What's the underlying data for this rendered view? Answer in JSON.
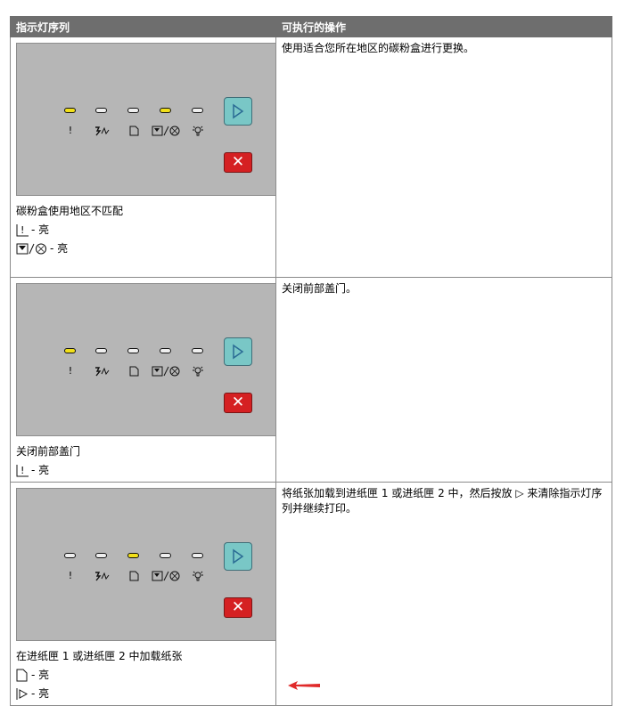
{
  "header": {
    "col1": "指示灯序列",
    "col2": "可执行的操作"
  },
  "rows": [
    {
      "leds": [
        true,
        false,
        false,
        true,
        false
      ],
      "title": "碳粉盒使用地区不匹配",
      "status_lines": [
        "- 亮",
        "- 亮"
      ],
      "action": "使用适合您所在地区的碳粉盒进行更换。"
    },
    {
      "leds": [
        true,
        false,
        false,
        false,
        false
      ],
      "title": "关闭前部盖门",
      "status_lines": [
        "- 亮"
      ],
      "action": "关闭前部盖门。"
    },
    {
      "leds": [
        false,
        false,
        true,
        false,
        false
      ],
      "title": "在进纸匣 1 或进纸匣 2 中加载纸张",
      "status_lines": [
        "- 亮",
        "- 亮"
      ],
      "action": "将纸张加载到进纸匣 1 或进纸匣 2 中，然后按放 ▷ 来清除指示灯序列并继续打印。"
    }
  ],
  "panel_symbols": {
    "exclamation": "!",
    "cancel": "✕"
  },
  "icons": [
    "attention-icon",
    "paper-jam-icon",
    "load-paper-icon",
    "toner-icon",
    "ready-icon",
    "go-button-icon",
    "cancel-icon",
    "back-arrow-icon"
  ],
  "colors": {
    "header_bg": "#6e6e6e",
    "panel_bg": "#b6b6b6",
    "led_on": "#f2e019",
    "go_button": "#79c7c6",
    "cancel_button": "#d52022",
    "nav_arrow": "#e02a2a"
  }
}
